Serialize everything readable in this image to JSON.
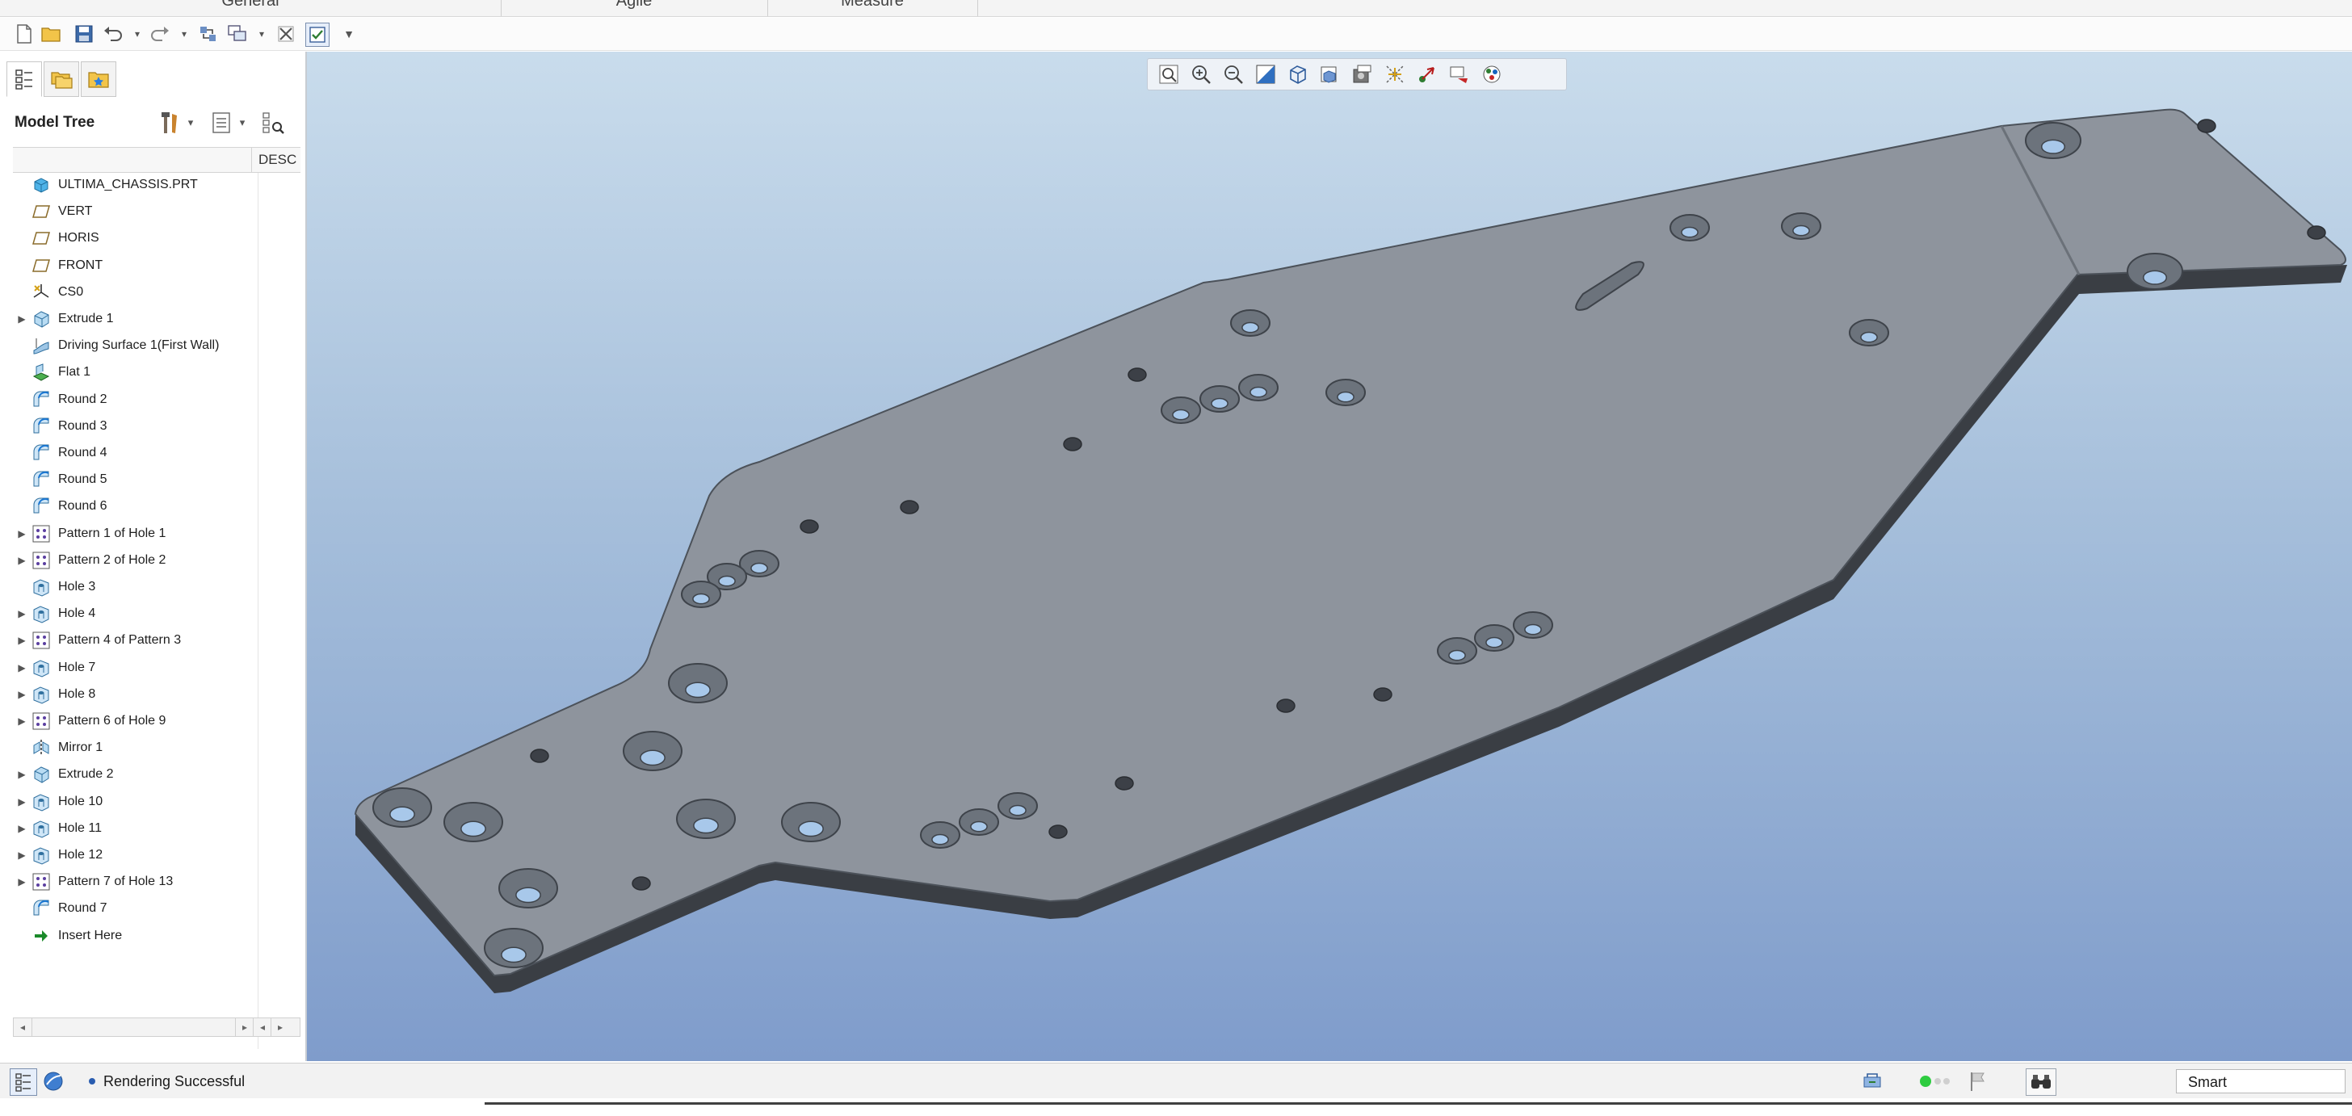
{
  "ribbon": {
    "groups": [
      "General",
      "Agile",
      "Measure"
    ]
  },
  "model_tree": {
    "title": "Model Tree",
    "column_header": "DESC",
    "items": [
      {
        "label": "ULTIMA_CHASSIS.PRT",
        "icon": "part-icon",
        "expandable": false
      },
      {
        "label": "VERT",
        "icon": "datum-plane-icon",
        "expandable": false
      },
      {
        "label": "HORIS",
        "icon": "datum-plane-icon",
        "expandable": false
      },
      {
        "label": "FRONT",
        "icon": "datum-plane-icon",
        "expandable": false
      },
      {
        "label": "CS0",
        "icon": "coordinate-system-icon",
        "expandable": false
      },
      {
        "label": "Extrude 1",
        "icon": "extrude-icon",
        "expandable": true
      },
      {
        "label": "Driving Surface 1(First Wall)",
        "icon": "surface-icon",
        "expandable": false
      },
      {
        "label": "Flat 1",
        "icon": "flat-icon",
        "expandable": false
      },
      {
        "label": "Round 2",
        "icon": "round-icon",
        "expandable": false
      },
      {
        "label": "Round 3",
        "icon": "round-icon",
        "expandable": false
      },
      {
        "label": "Round 4",
        "icon": "round-icon",
        "expandable": false
      },
      {
        "label": "Round 5",
        "icon": "round-icon",
        "expandable": false
      },
      {
        "label": "Round 6",
        "icon": "round-icon",
        "expandable": false
      },
      {
        "label": "Pattern 1 of Hole 1",
        "icon": "pattern-icon",
        "expandable": true
      },
      {
        "label": "Pattern 2 of Hole 2",
        "icon": "pattern-icon",
        "expandable": true
      },
      {
        "label": "Hole 3",
        "icon": "hole-icon",
        "expandable": false
      },
      {
        "label": "Hole 4",
        "icon": "hole-icon",
        "expandable": true
      },
      {
        "label": "Pattern 4 of Pattern 3",
        "icon": "pattern-icon",
        "expandable": true
      },
      {
        "label": "Hole 7",
        "icon": "hole-icon",
        "expandable": true
      },
      {
        "label": "Hole 8",
        "icon": "hole-icon",
        "expandable": true
      },
      {
        "label": "Pattern 6 of Hole 9",
        "icon": "pattern-icon",
        "expandable": true
      },
      {
        "label": "Mirror 1",
        "icon": "mirror-icon",
        "expandable": false
      },
      {
        "label": "Extrude 2",
        "icon": "extrude-icon",
        "expandable": true
      },
      {
        "label": "Hole 10",
        "icon": "hole-icon",
        "expandable": true
      },
      {
        "label": "Hole 11",
        "icon": "hole-icon",
        "expandable": true
      },
      {
        "label": "Hole 12",
        "icon": "hole-icon",
        "expandable": true
      },
      {
        "label": "Pattern 7 of Hole 13",
        "icon": "pattern-icon",
        "expandable": true
      },
      {
        "label": "Round 7",
        "icon": "round-icon",
        "expandable": false
      },
      {
        "label": "Insert Here",
        "icon": "insert-arrow-icon",
        "expandable": false
      }
    ]
  },
  "status": {
    "message": "Rendering Successful",
    "filter_value": "Smart"
  },
  "colors": {
    "viewport_top": "#c9dcec",
    "viewport_bottom": "#7f9ccb",
    "part_face": "#8e949d",
    "part_edge": "#3a3e44",
    "hole_bore": "#a8c8ea",
    "status_led": "#2ecc40"
  }
}
